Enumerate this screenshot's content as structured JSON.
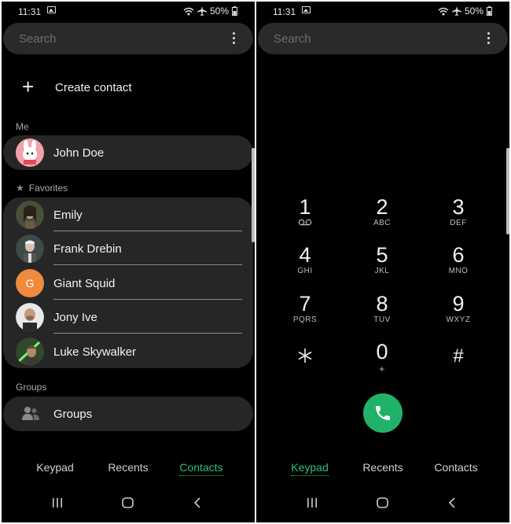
{
  "status": {
    "time": "11:31",
    "battery": "50%"
  },
  "search": {
    "placeholder": "Search"
  },
  "contacts": {
    "create_label": "Create contact",
    "me_header": "Me",
    "me": {
      "name": "John Doe"
    },
    "favorites_header": "Favorites",
    "favorites": [
      {
        "name": "Emily"
      },
      {
        "name": "Frank Drebin"
      },
      {
        "name": "Giant Squid",
        "initial": "G"
      },
      {
        "name": "Jony Ive"
      },
      {
        "name": "Luke Skywalker"
      }
    ],
    "groups_header": "Groups",
    "groups_label": "Groups"
  },
  "tabs": {
    "keypad": "Keypad",
    "recents": "Recents",
    "contacts": "Contacts"
  },
  "keypad": {
    "keys": [
      {
        "digit": "1",
        "letters": ""
      },
      {
        "digit": "2",
        "letters": "ABC"
      },
      {
        "digit": "3",
        "letters": "DEF"
      },
      {
        "digit": "4",
        "letters": "GHI"
      },
      {
        "digit": "5",
        "letters": "JKL"
      },
      {
        "digit": "6",
        "letters": "MNO"
      },
      {
        "digit": "7",
        "letters": "PQRS"
      },
      {
        "digit": "8",
        "letters": "TUV"
      },
      {
        "digit": "9",
        "letters": "WXYZ"
      },
      {
        "digit": "*",
        "letters": ""
      },
      {
        "digit": "0",
        "letters": "+"
      },
      {
        "digit": "#",
        "letters": ""
      }
    ]
  },
  "colors": {
    "accent": "#29c07c",
    "call_button": "#21b26a",
    "card": "#262626",
    "background": "#000000"
  },
  "icons": {
    "status": [
      "gallery-icon",
      "wifi-icon",
      "airplane-icon",
      "battery-icon"
    ],
    "nav": [
      "recent-apps-icon",
      "home-icon",
      "back-icon"
    ]
  }
}
